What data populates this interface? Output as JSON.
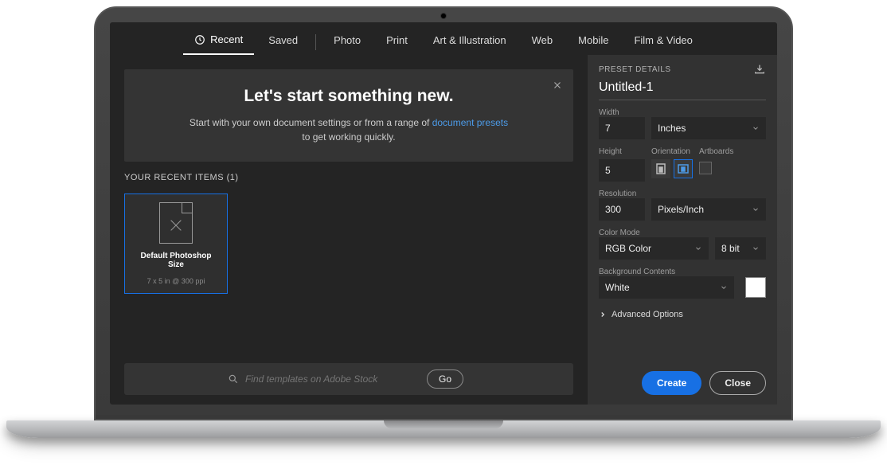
{
  "tabs": {
    "recent": "Recent",
    "saved": "Saved",
    "photo": "Photo",
    "print": "Print",
    "art": "Art & Illustration",
    "web": "Web",
    "mobile": "Mobile",
    "film": "Film & Video"
  },
  "banner": {
    "title": "Let's start something new.",
    "line1": "Start with your own document settings or from a range of ",
    "link": "document presets",
    "line2": " to get working quickly."
  },
  "recent": {
    "header": "YOUR RECENT ITEMS  (1)",
    "card_title": "Default Photoshop Size",
    "card_sub": "7 x 5 in @ 300 ppi"
  },
  "search": {
    "placeholder": "Find templates on Adobe Stock",
    "go": "Go"
  },
  "side": {
    "header": "PRESET DETAILS",
    "docname": "Untitled-1",
    "width_lbl": "Width",
    "width_val": "7",
    "width_unit": "Inches",
    "height_lbl": "Height",
    "height_val": "5",
    "orient_lbl": "Orientation",
    "artboards_lbl": "Artboards",
    "res_lbl": "Resolution",
    "res_val": "300",
    "res_unit": "Pixels/Inch",
    "color_lbl": "Color Mode",
    "color_mode": "RGB Color",
    "color_depth": "8 bit",
    "bg_lbl": "Background Contents",
    "bg_val": "White",
    "advanced": "Advanced Options"
  },
  "buttons": {
    "create": "Create",
    "close": "Close"
  }
}
